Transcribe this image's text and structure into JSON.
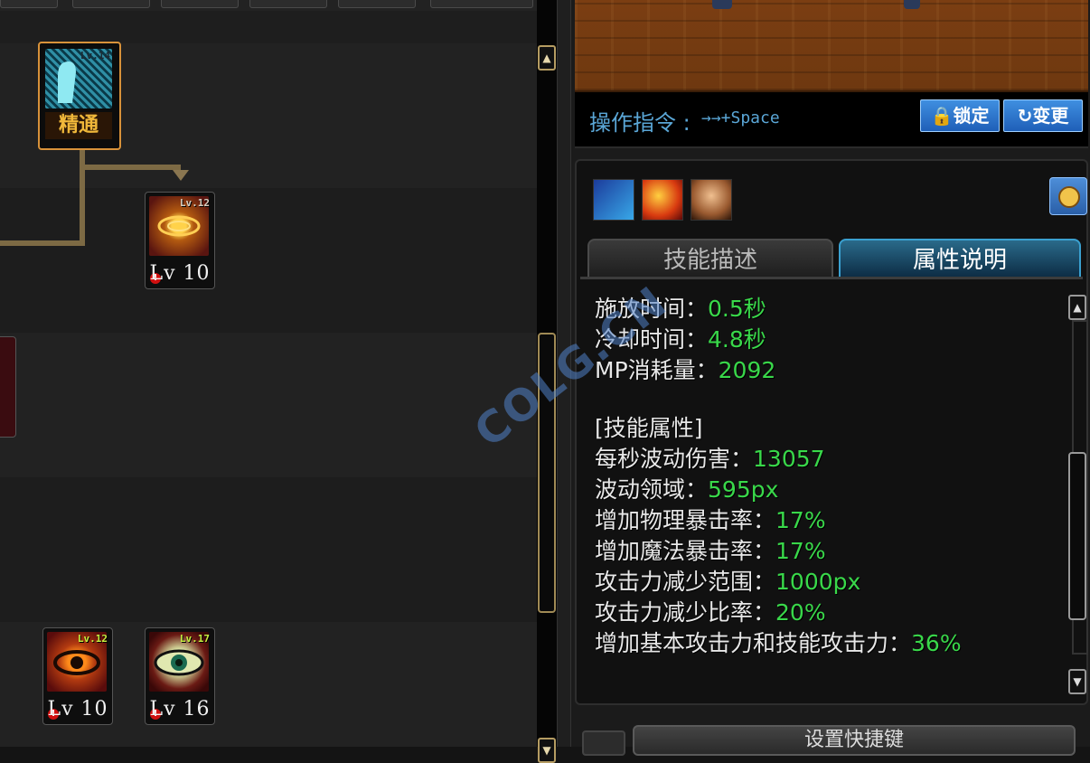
{
  "skill_tree": {
    "mastery": {
      "level_tag": "Lv.14",
      "label": "精通"
    },
    "skills": [
      {
        "id": "wave-skill",
        "level_tag": "Lv.12",
        "level_label": "Lv 10"
      },
      {
        "id": "eye-skill-1",
        "level_tag": "Lv.12",
        "level_label": "Lv 10"
      },
      {
        "id": "eye-skill-2",
        "level_tag": "Lv.17",
        "level_label": "Lv 16"
      }
    ]
  },
  "command": {
    "label": "操作指令 :",
    "keys": "→→+Space",
    "lock_label": "锁定",
    "change_label": "变更"
  },
  "tabs": {
    "skill_desc": "技能描述",
    "attr_desc": "属性说明"
  },
  "attributes": {
    "cast_time": {
      "label": "施放时间：",
      "value": "0.5秒"
    },
    "cooldown": {
      "label": "冷却时间：",
      "value": "4.8秒"
    },
    "mp_cost": {
      "label": "MP消耗量：",
      "value": "2092"
    },
    "section_title": "[技能属性]",
    "wave_damage": {
      "label": "每秒波动伤害：",
      "value": "13057"
    },
    "wave_area": {
      "label": "波动领域：",
      "value": "595px"
    },
    "phys_crit": {
      "label": "增加物理暴击率：",
      "value": "17%"
    },
    "magic_crit": {
      "label": "增加魔法暴击率：",
      "value": "17%"
    },
    "atk_reduce_range": {
      "label": "攻击力减少范围：",
      "value": "1000px"
    },
    "atk_reduce_rate": {
      "label": "攻击力减少比率：",
      "value": "20%"
    },
    "base_atk_increase": {
      "label": "增加基本攻击力和技能攻击力：",
      "value": "36%"
    }
  },
  "hotkey_button": "设置快捷键",
  "watermark": "COLG.CN",
  "colors": {
    "accent_blue": "#5aa6d6",
    "value_green": "#39d84a",
    "tree_line": "#7d6a44"
  }
}
